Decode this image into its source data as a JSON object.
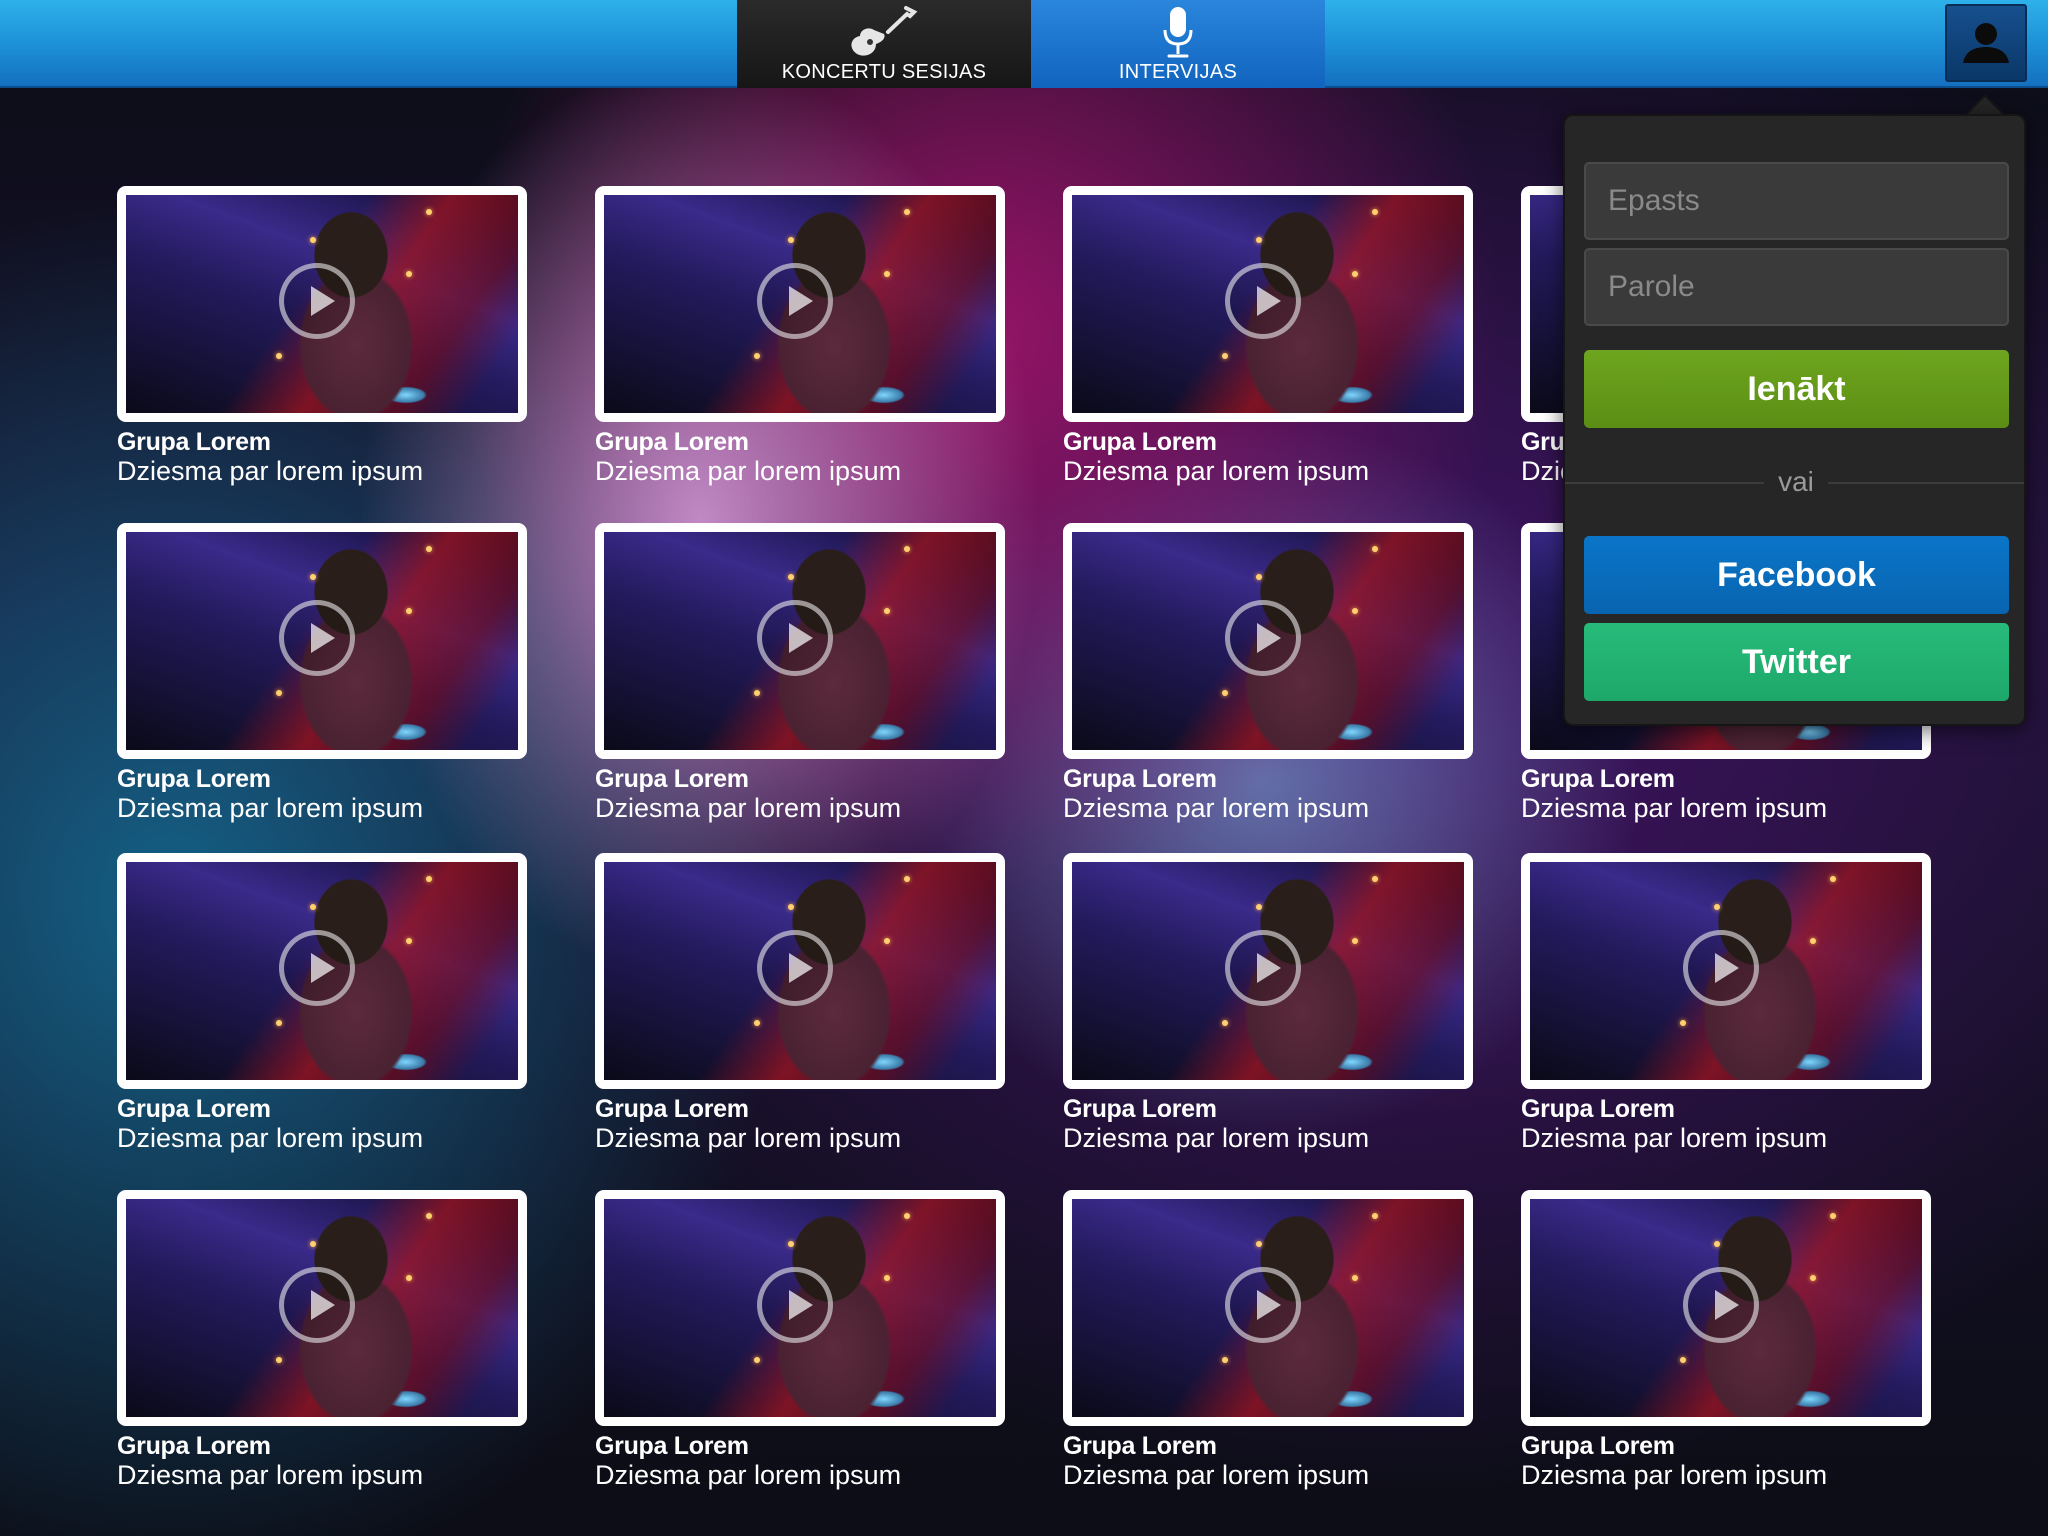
{
  "topbar": {
    "tabs": [
      {
        "label": "KONCERTU SESIJAS",
        "icon": "guitar-icon",
        "active": false
      },
      {
        "label": "INTERVIJAS",
        "icon": "microphone-icon",
        "active": true
      }
    ],
    "user_icon": "user-icon"
  },
  "grid": {
    "rows": 4,
    "columns": 4,
    "items": [
      {
        "title": "Grupa Lorem",
        "subtitle": "Dziesma par lorem ipsum"
      },
      {
        "title": "Grupa Lorem",
        "subtitle": "Dziesma par lorem ipsum"
      },
      {
        "title": "Grupa Lorem",
        "subtitle": "Dziesma par lorem ipsum"
      },
      {
        "title": "Grupa Lorem",
        "subtitle": "Dziesma par lorem ipsum"
      },
      {
        "title": "Grupa Lorem",
        "subtitle": "Dziesma par lorem ipsum"
      },
      {
        "title": "Grupa Lorem",
        "subtitle": "Dziesma par lorem ipsum"
      },
      {
        "title": "Grupa Lorem",
        "subtitle": "Dziesma par lorem ipsum"
      },
      {
        "title": "Grupa Lorem",
        "subtitle": "Dziesma par lorem ipsum"
      },
      {
        "title": "Grupa Lorem",
        "subtitle": "Dziesma par lorem ipsum"
      },
      {
        "title": "Grupa Lorem",
        "subtitle": "Dziesma par lorem ipsum"
      },
      {
        "title": "Grupa Lorem",
        "subtitle": "Dziesma par lorem ipsum"
      },
      {
        "title": "Grupa Lorem",
        "subtitle": "Dziesma par lorem ipsum"
      },
      {
        "title": "Grupa Lorem",
        "subtitle": "Dziesma par lorem ipsum"
      },
      {
        "title": "Grupa Lorem",
        "subtitle": "Dziesma par lorem ipsum"
      },
      {
        "title": "Grupa Lorem",
        "subtitle": "Dziesma par lorem ipsum"
      },
      {
        "title": "Grupa Lorem",
        "subtitle": "Dziesma par lorem ipsum"
      }
    ]
  },
  "login": {
    "email_placeholder": "Epasts",
    "password_placeholder": "Parole",
    "login_label": "Ienākt",
    "or_label": "vai",
    "facebook_label": "Facebook",
    "twitter_label": "Twitter"
  },
  "colors": {
    "topbar": "#1c8fd6",
    "active_tab": "#1a72cc",
    "login_button": "#659b1a",
    "facebook_button": "#0a6fbe",
    "twitter_button": "#23b373",
    "popover_bg": "#262626"
  }
}
